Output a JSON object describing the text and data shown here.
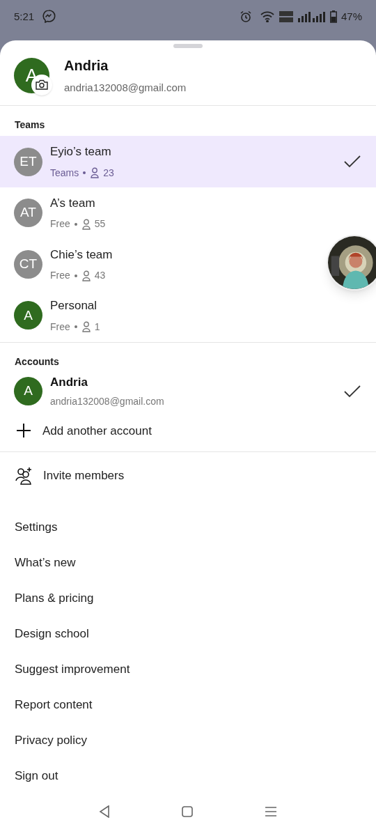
{
  "status_bar": {
    "time": "5:21",
    "battery": "47%"
  },
  "profile": {
    "initial": "A",
    "name": "Andria",
    "email": "andria132008@gmail.com"
  },
  "teams": {
    "heading": "Teams",
    "items": [
      {
        "initials": "ET",
        "color": "#8c8c8c",
        "name": "Eyio’s team",
        "plan": "Teams",
        "members": "23",
        "selected": true
      },
      {
        "initials": "AT",
        "color": "#8c8c8c",
        "name": "A’s team",
        "plan": "Free",
        "members": "55",
        "selected": false
      },
      {
        "initials": "CT",
        "color": "#8c8c8c",
        "name": "Chie’s team",
        "plan": "Free",
        "members": "43",
        "selected": false
      },
      {
        "initials": "A",
        "color": "#2f6b1f",
        "name": "Personal",
        "plan": "Free",
        "members": "1",
        "selected": false
      }
    ]
  },
  "accounts": {
    "heading": "Accounts",
    "items": [
      {
        "initial": "A",
        "color": "#2f6b1f",
        "name": "Andria",
        "email": "andria132008@gmail.com",
        "selected": true
      }
    ],
    "add_label": "Add another account"
  },
  "invite": "Invite members",
  "menu": [
    "Settings",
    "What’s new",
    "Plans & pricing",
    "Design school",
    "Suggest improvement",
    "Report content",
    "Privacy policy",
    "Sign out"
  ]
}
